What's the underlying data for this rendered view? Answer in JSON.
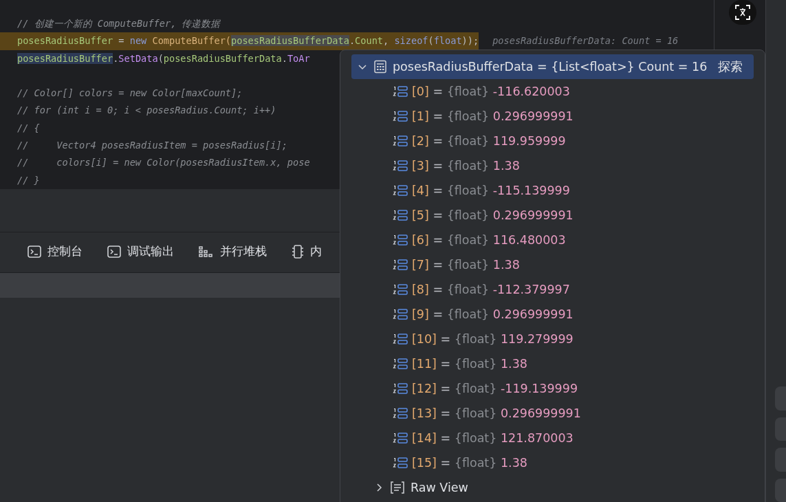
{
  "editor": {
    "blocks": [
      [
        {
          "highlight": false,
          "tokens": [
            {
              "kind": "comment",
              "text": "// 创建一个新的 ComputeBuffer, 传递数据"
            }
          ]
        },
        {
          "highlight": true,
          "tokens": [
            {
              "kind": "var",
              "text": "posesRadiusBuffer"
            },
            {
              "kind": "plain",
              "text": " = "
            },
            {
              "kind": "keyword",
              "text": "new"
            },
            {
              "kind": "type",
              "text": " ComputeBuffer("
            },
            {
              "kind": "var_read",
              "text": "posesRadiusBufferData"
            },
            {
              "kind": "plain",
              "text": "."
            },
            {
              "kind": "var",
              "text": "Count"
            },
            {
              "kind": "plain",
              "text": ", "
            },
            {
              "kind": "keyword",
              "text": "sizeof"
            },
            {
              "kind": "plain",
              "text": "("
            },
            {
              "kind": "keyword",
              "text": "float"
            },
            {
              "kind": "plain",
              "text": "));"
            }
          ],
          "hint": "posesRadiusBufferData: Count = 16"
        },
        {
          "highlight": false,
          "tokens": [
            {
              "kind": "var_write",
              "text": "posesRadiusBuffer"
            },
            {
              "kind": "plain",
              "text": "."
            },
            {
              "kind": "method",
              "text": "SetData"
            },
            {
              "kind": "plain",
              "text": "("
            },
            {
              "kind": "var",
              "text": "posesRadiusBufferData"
            },
            {
              "kind": "plain",
              "text": "."
            },
            {
              "kind": "method",
              "text": "ToAr"
            }
          ]
        }
      ],
      [
        {
          "highlight": false,
          "tokens": [
            {
              "kind": "comment",
              "text": "// Color[] colors = new Color[maxCount];"
            }
          ]
        },
        {
          "highlight": false,
          "tokens": [
            {
              "kind": "comment",
              "text": "// for (int i = 0; i < posesRadius.Count; i++)"
            }
          ]
        },
        {
          "highlight": false,
          "tokens": [
            {
              "kind": "comment",
              "text": "// {"
            }
          ]
        },
        {
          "highlight": false,
          "tokens": [
            {
              "kind": "comment",
              "text": "//     Vector4 posesRadiusItem = posesRadius[i];"
            }
          ]
        },
        {
          "highlight": false,
          "tokens": [
            {
              "kind": "comment",
              "text": "//     colors[i] = new Color(posesRadiusItem.x, pose"
            }
          ]
        },
        {
          "highlight": false,
          "tokens": [
            {
              "kind": "comment",
              "text": "// }"
            }
          ]
        }
      ]
    ]
  },
  "tabs": [
    {
      "label": "控制台",
      "kind": "terminal",
      "selected": false
    },
    {
      "label": "调试输出",
      "kind": "terminal",
      "selected": false
    },
    {
      "label": "并行堆栈",
      "kind": "stacks",
      "selected": false
    },
    {
      "label": "内",
      "kind": "chip",
      "selected": false
    }
  ],
  "datatip": {
    "header": {
      "text": "posesRadiusBufferData = {List<float>} Count = 16",
      "expanded": true,
      "selected": true,
      "link": "探索"
    },
    "items": [
      {
        "index": "[0]",
        "eq": "=",
        "type": "{float}",
        "value": "-116.620003"
      },
      {
        "index": "[1]",
        "eq": "=",
        "type": "{float}",
        "value": "0.296999991"
      },
      {
        "index": "[2]",
        "eq": "=",
        "type": "{float}",
        "value": "119.959999"
      },
      {
        "index": "[3]",
        "eq": "=",
        "type": "{float}",
        "value": "1.38"
      },
      {
        "index": "[4]",
        "eq": "=",
        "type": "{float}",
        "value": "-115.139999"
      },
      {
        "index": "[5]",
        "eq": "=",
        "type": "{float}",
        "value": "0.296999991"
      },
      {
        "index": "[6]",
        "eq": "=",
        "type": "{float}",
        "value": "116.480003"
      },
      {
        "index": "[7]",
        "eq": "=",
        "type": "{float}",
        "value": "1.38"
      },
      {
        "index": "[8]",
        "eq": "=",
        "type": "{float}",
        "value": "-112.379997"
      },
      {
        "index": "[9]",
        "eq": "=",
        "type": "{float}",
        "value": "0.296999991"
      },
      {
        "index": "[10]",
        "eq": "=",
        "type": "{float}",
        "value": "119.279999"
      },
      {
        "index": "[11]",
        "eq": "=",
        "type": "{float}",
        "value": "1.38"
      },
      {
        "index": "[12]",
        "eq": "=",
        "type": "{float}",
        "value": "-119.139999"
      },
      {
        "index": "[13]",
        "eq": "=",
        "type": "{float}",
        "value": "0.296999991"
      },
      {
        "index": "[14]",
        "eq": "=",
        "type": "{float}",
        "value": "121.870003"
      },
      {
        "index": "[15]",
        "eq": "=",
        "type": "{float}",
        "value": "1.38"
      }
    ],
    "raw_view": {
      "label": "Raw View",
      "expanded": false
    }
  }
}
